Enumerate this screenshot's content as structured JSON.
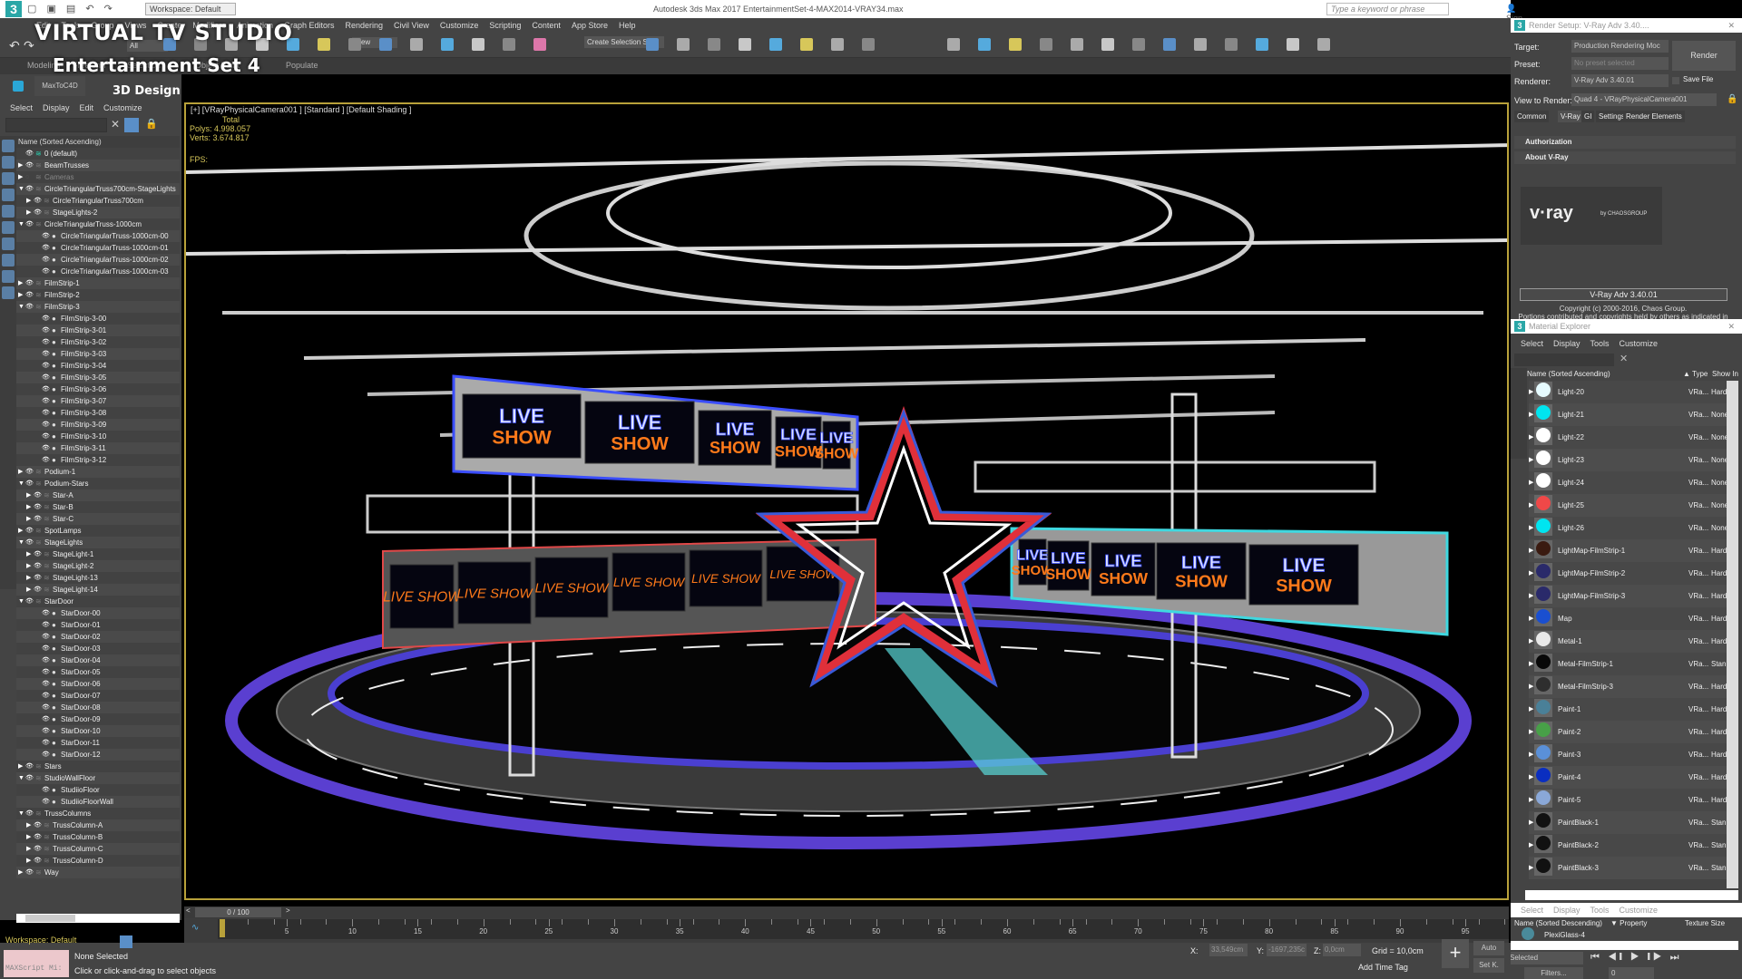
{
  "titlebar": {
    "app_title": "Autodesk 3ds Max 2017     EntertainmentSet-4-MAX2014-VRAY34.max",
    "workspace": "Workspace: Default",
    "search_placeholder": "Type a keyword or phrase",
    "sign_in": "Sign In"
  },
  "overlay": {
    "title": "VIRTUAL TV STUDIO",
    "subtitle": "Entertainment Set 4",
    "tagline": "3D Design"
  },
  "menubar": [
    "Edit",
    "Tools",
    "Group",
    "Views",
    "Create",
    "Modifiers",
    "Animation",
    "Graph Editors",
    "Rendering",
    "Civil View",
    "Customize",
    "Scripting",
    "Content",
    "App Store",
    "Help"
  ],
  "toolbar": {
    "selection_filter": "All",
    "reference_coord": "View",
    "create_selection_set": "Create Selection Set"
  },
  "ribbon": {
    "tabs": [
      "Modeling",
      "Freeform",
      "Selection",
      "Object Paint",
      "Populate"
    ]
  },
  "plugin_bar": {
    "label": "MaxToC4D"
  },
  "scene_explorer": {
    "menu": [
      "Select",
      "Display",
      "Edit",
      "Customize"
    ],
    "column_header": "Name (Sorted Ascending)",
    "rows": [
      {
        "label": "0 (default)",
        "level": 0,
        "expander": "none",
        "kind": "layer-active"
      },
      {
        "label": "BeamTrusses",
        "level": 0,
        "expander": "collapsed",
        "kind": "layer"
      },
      {
        "label": "Cameras",
        "level": 0,
        "expander": "collapsed",
        "kind": "layer-hidden"
      },
      {
        "label": "CircleTriangularTruss700cm-StageLights",
        "level": 0,
        "expander": "expanded",
        "kind": "layer"
      },
      {
        "label": "CircleTriangularTruss700cm",
        "level": 1,
        "expander": "collapsed",
        "kind": "layer"
      },
      {
        "label": "StageLights-2",
        "level": 1,
        "expander": "collapsed",
        "kind": "layer"
      },
      {
        "label": "CircleTriangularTruss-1000cm",
        "level": 0,
        "expander": "expanded",
        "kind": "layer"
      },
      {
        "label": "CircleTriangularTruss-1000cm-00",
        "level": 1,
        "expander": "none",
        "kind": "object"
      },
      {
        "label": "CircleTriangularTruss-1000cm-01",
        "level": 1,
        "expander": "none",
        "kind": "object"
      },
      {
        "label": "CircleTriangularTruss-1000cm-02",
        "level": 1,
        "expander": "none",
        "kind": "object"
      },
      {
        "label": "CircleTriangularTruss-1000cm-03",
        "level": 1,
        "expander": "none",
        "kind": "object"
      },
      {
        "label": "FilmStrip-1",
        "level": 0,
        "expander": "collapsed",
        "kind": "layer"
      },
      {
        "label": "FilmStrip-2",
        "level": 0,
        "expander": "collapsed",
        "kind": "layer"
      },
      {
        "label": "FilmStrip-3",
        "level": 0,
        "expander": "expanded",
        "kind": "layer"
      },
      {
        "label": "FilmStrip-3-00",
        "level": 1,
        "expander": "none",
        "kind": "object"
      },
      {
        "label": "FilmStrip-3-01",
        "level": 1,
        "expander": "none",
        "kind": "object"
      },
      {
        "label": "FilmStrip-3-02",
        "level": 1,
        "expander": "none",
        "kind": "object"
      },
      {
        "label": "FilmStrip-3-03",
        "level": 1,
        "expander": "none",
        "kind": "object"
      },
      {
        "label": "FilmStrip-3-04",
        "level": 1,
        "expander": "none",
        "kind": "object"
      },
      {
        "label": "FilmStrip-3-05",
        "level": 1,
        "expander": "none",
        "kind": "object"
      },
      {
        "label": "FilmStrip-3-06",
        "level": 1,
        "expander": "none",
        "kind": "object"
      },
      {
        "label": "FilmStrip-3-07",
        "level": 1,
        "expander": "none",
        "kind": "object"
      },
      {
        "label": "FilmStrip-3-08",
        "level": 1,
        "expander": "none",
        "kind": "object"
      },
      {
        "label": "FilmStrip-3-09",
        "level": 1,
        "expander": "none",
        "kind": "object"
      },
      {
        "label": "FilmStrip-3-10",
        "level": 1,
        "expander": "none",
        "kind": "object"
      },
      {
        "label": "FilmStrip-3-11",
        "level": 1,
        "expander": "none",
        "kind": "object"
      },
      {
        "label": "FilmStrip-3-12",
        "level": 1,
        "expander": "none",
        "kind": "object"
      },
      {
        "label": "Podium-1",
        "level": 0,
        "expander": "collapsed",
        "kind": "layer"
      },
      {
        "label": "Podium-Stars",
        "level": 0,
        "expander": "expanded",
        "kind": "layer"
      },
      {
        "label": "Star-A",
        "level": 1,
        "expander": "collapsed",
        "kind": "layer"
      },
      {
        "label": "Star-B",
        "level": 1,
        "expander": "collapsed",
        "kind": "layer"
      },
      {
        "label": "Star-C",
        "level": 1,
        "expander": "collapsed",
        "kind": "layer"
      },
      {
        "label": "SpotLamps",
        "level": 0,
        "expander": "collapsed",
        "kind": "layer"
      },
      {
        "label": "StageLights",
        "level": 0,
        "expander": "expanded",
        "kind": "layer"
      },
      {
        "label": "StageLight-1",
        "level": 1,
        "expander": "collapsed",
        "kind": "layer"
      },
      {
        "label": "StageLight-2",
        "level": 1,
        "expander": "collapsed",
        "kind": "layer"
      },
      {
        "label": "StageLight-13",
        "level": 1,
        "expander": "collapsed",
        "kind": "layer"
      },
      {
        "label": "StageLight-14",
        "level": 1,
        "expander": "collapsed",
        "kind": "layer"
      },
      {
        "label": "StarDoor",
        "level": 0,
        "expander": "expanded",
        "kind": "layer"
      },
      {
        "label": "StarDoor-00",
        "level": 1,
        "expander": "none",
        "kind": "object"
      },
      {
        "label": "StarDoor-01",
        "level": 1,
        "expander": "none",
        "kind": "object"
      },
      {
        "label": "StarDoor-02",
        "level": 1,
        "expander": "none",
        "kind": "object"
      },
      {
        "label": "StarDoor-03",
        "level": 1,
        "expander": "none",
        "kind": "object"
      },
      {
        "label": "StarDoor-04",
        "level": 1,
        "expander": "none",
        "kind": "object"
      },
      {
        "label": "StarDoor-05",
        "level": 1,
        "expander": "none",
        "kind": "object"
      },
      {
        "label": "StarDoor-06",
        "level": 1,
        "expander": "none",
        "kind": "object"
      },
      {
        "label": "StarDoor-07",
        "level": 1,
        "expander": "none",
        "kind": "object"
      },
      {
        "label": "StarDoor-08",
        "level": 1,
        "expander": "none",
        "kind": "object"
      },
      {
        "label": "StarDoor-09",
        "level": 1,
        "expander": "none",
        "kind": "object"
      },
      {
        "label": "StarDoor-10",
        "level": 1,
        "expander": "none",
        "kind": "object"
      },
      {
        "label": "StarDoor-11",
        "level": 1,
        "expander": "none",
        "kind": "object"
      },
      {
        "label": "StarDoor-12",
        "level": 1,
        "expander": "none",
        "kind": "object"
      },
      {
        "label": "Stars",
        "level": 0,
        "expander": "collapsed",
        "kind": "layer"
      },
      {
        "label": "StudioWallFloor",
        "level": 0,
        "expander": "expanded",
        "kind": "layer"
      },
      {
        "label": "StudiioFloor",
        "level": 1,
        "expander": "none",
        "kind": "object"
      },
      {
        "label": "StudiioFloorWall",
        "level": 1,
        "expander": "none",
        "kind": "object"
      },
      {
        "label": "TrussColumns",
        "level": 0,
        "expander": "expanded",
        "kind": "layer"
      },
      {
        "label": "TrussColumn-A",
        "level": 1,
        "expander": "collapsed",
        "kind": "layer"
      },
      {
        "label": "TrussColumn-B",
        "level": 1,
        "expander": "collapsed",
        "kind": "layer"
      },
      {
        "label": "TrussColumn-C",
        "level": 1,
        "expander": "collapsed",
        "kind": "layer"
      },
      {
        "label": "TrussColumn-D",
        "level": 1,
        "expander": "collapsed",
        "kind": "layer"
      },
      {
        "label": "Way",
        "level": 0,
        "expander": "collapsed",
        "kind": "layer"
      }
    ]
  },
  "viewport": {
    "label": "[+] [VRayPhysicalCamera001 ] [Standard ] [Default Shading ]",
    "stats_header": "Total",
    "polys_label": "Polys:",
    "polys_value": "4.998.057",
    "verts_label": "Verts:",
    "verts_value": "3.674.817",
    "fps_label": "FPS:",
    "screen_text_top": [
      "LIVE",
      "SHOW"
    ],
    "screen_text_bottom": "LIVE SHOW",
    "colors": {
      "blue_neon": "#3a4dff",
      "orange_neon": "#ff7a1a",
      "star_red": "#e0303a",
      "star_blue": "#3a5ad8",
      "floor_ring": "#5a3fd0",
      "cyan_edge": "#3fd8e0"
    }
  },
  "render_setup": {
    "window_title": "Render Setup: V-Ray Adv 3.40....",
    "target_label": "Target:",
    "target_value": "Production Rendering Moc",
    "preset_label": "Preset:",
    "preset_value": "No preset selected",
    "renderer_label": "Renderer:",
    "renderer_value": "V-Ray Adv 3.40.01",
    "save_file_label": "Save File",
    "view_label": "View to Render:",
    "view_value": "Quad 4 - VRayPhysicalCamera001",
    "render_button": "Render",
    "tabs": [
      "Common",
      "V-Ray",
      "GI",
      "Settings",
      "Render Elements"
    ],
    "active_tab": "V-Ray",
    "rollouts": [
      "Authorization",
      "About V-Ray"
    ],
    "vray_logo_text": "v·ray",
    "vray_by": "by CHAOSGROUP",
    "version_label": "V-Ray Adv 3.40.01",
    "copyright": "Copyright (c) 2000-2016, Chaos Group.",
    "portions": "Portions contributed and copyrights held by others as indicated in the V-Ray help index."
  },
  "material_explorer": {
    "window_title": "Material Explorer",
    "menu": [
      "Select",
      "Display",
      "Tools",
      "Customize"
    ],
    "col_name": "Name (Sorted Ascending)",
    "col_type": "▲ Type",
    "col_show": "Show In",
    "rows": [
      {
        "name": "Light-20",
        "type": "VRa...",
        "show": "Hard",
        "swatch": "#e6fbff"
      },
      {
        "name": "Light-21",
        "type": "VRa...",
        "show": "None",
        "swatch": "#00e5f0"
      },
      {
        "name": "Light-22",
        "type": "VRa...",
        "show": "None",
        "swatch": "#ffffff"
      },
      {
        "name": "Light-23",
        "type": "VRa...",
        "show": "None",
        "swatch": "#ffffff"
      },
      {
        "name": "Light-24",
        "type": "VRa...",
        "show": "None",
        "swatch": "#ffffff"
      },
      {
        "name": "Light-25",
        "type": "VRa...",
        "show": "None",
        "swatch": "#f04848"
      },
      {
        "name": "Light-26",
        "type": "VRa...",
        "show": "None",
        "swatch": "#00e5f0"
      },
      {
        "name": "LightMap-FilmStrip-1",
        "type": "VRa...",
        "show": "Hard",
        "swatch": "#3a1a10"
      },
      {
        "name": "LightMap-FilmStrip-2",
        "type": "VRa...",
        "show": "Hard",
        "swatch": "#2a2a6a"
      },
      {
        "name": "LightMap-FilmStrip-3",
        "type": "VRa...",
        "show": "Hard",
        "swatch": "#2a2a6a"
      },
      {
        "name": "Map",
        "type": "VRa...",
        "show": "Hard",
        "swatch": "#1a4fd0"
      },
      {
        "name": "Metal-1",
        "type": "VRa...",
        "show": "Hard",
        "swatch": "#e8e8e8"
      },
      {
        "name": "Metal-FilmStrip-1",
        "type": "VRa...",
        "show": "Stan",
        "swatch": "#080808"
      },
      {
        "name": "Metal-FilmStrip-3",
        "type": "VRa...",
        "show": "Hard",
        "swatch": "#2e2e2e"
      },
      {
        "name": "Paint-1",
        "type": "VRa...",
        "show": "Hard",
        "swatch": "#4a8098"
      },
      {
        "name": "Paint-2",
        "type": "VRa...",
        "show": "Hard",
        "swatch": "#48a048"
      },
      {
        "name": "Paint-3",
        "type": "VRa...",
        "show": "Hard",
        "swatch": "#5a90d8"
      },
      {
        "name": "Paint-4",
        "type": "VRa...",
        "show": "Hard",
        "swatch": "#0a2ec0"
      },
      {
        "name": "Paint-5",
        "type": "VRa...",
        "show": "Hard",
        "swatch": "#8aa8d8"
      },
      {
        "name": "PaintBlack-1",
        "type": "VRa...",
        "show": "Stan",
        "swatch": "#111111"
      },
      {
        "name": "PaintBlack-2",
        "type": "VRa...",
        "show": "Stan",
        "swatch": "#111111"
      },
      {
        "name": "PaintBlack-3",
        "type": "VRa...",
        "show": "Stan",
        "swatch": "#111111"
      }
    ],
    "lower_menu": [
      "Select",
      "Display",
      "Tools",
      "Customize"
    ],
    "lower_col_name": "Name (Sorted Descending)",
    "lower_col_property": "▼ Property",
    "lower_col_texture": "Texture Size",
    "lower_row": "PlexiGlass-4"
  },
  "timeline": {
    "frame_display": "0 / 100",
    "current_frame": 0,
    "start": 0,
    "end": 100,
    "labels": [
      "0",
      "5",
      "10",
      "15",
      "20",
      "25",
      "30",
      "35",
      "40",
      "45",
      "50",
      "55",
      "60",
      "65",
      "70",
      "75",
      "80",
      "85",
      "90",
      "95"
    ]
  },
  "statusbar": {
    "workspace": "Workspace: Default",
    "maxscript": "MAXScript Mi:",
    "selection": "None Selected",
    "prompt": "Click or click-and-drag to select objects",
    "x_label": "X:",
    "x_value": "33,549cm",
    "y_label": "Y:",
    "y_value": "-1697,235c",
    "z_label": "Z:",
    "z_value": "0,0cm",
    "grid": "Grid = 10,0cm",
    "add_time_tag": "Add Time Tag",
    "auto": "Auto",
    "set_key": "Set K.",
    "key_filter": "Selected",
    "filters": "Filters...",
    "frame_field": "0"
  }
}
